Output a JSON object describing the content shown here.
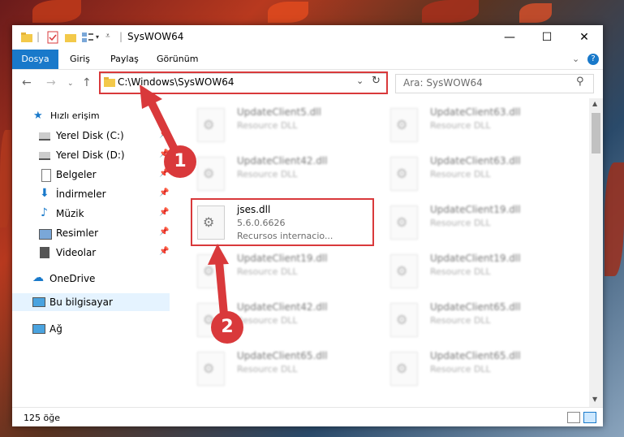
{
  "window": {
    "title": "SysWOW64",
    "minimize": "—",
    "maximize": "☐",
    "close": "✕"
  },
  "ribbon": {
    "tabs": [
      "Dosya",
      "Giriş",
      "Paylaş",
      "Görünüm"
    ]
  },
  "address": {
    "path": "C:\\Windows\\SysWOW64"
  },
  "search": {
    "placeholder": "Ara: SysWOW64"
  },
  "sidebar": {
    "items": [
      {
        "label": "Hızlı erişim",
        "icon": "star-icon"
      },
      {
        "label": "Yerel Disk (C:)",
        "icon": "drive-icon"
      },
      {
        "label": "Yerel Disk (D:)",
        "icon": "drive-icon"
      },
      {
        "label": "Belgeler",
        "icon": "documents-icon"
      },
      {
        "label": "İndirmeler",
        "icon": "download-icon"
      },
      {
        "label": "Müzik",
        "icon": "music-icon"
      },
      {
        "label": "Resimler",
        "icon": "pictures-icon"
      },
      {
        "label": "Videolar",
        "icon": "video-icon"
      },
      {
        "label": "OneDrive",
        "icon": "cloud-icon"
      },
      {
        "label": "Bu bilgisayar",
        "icon": "computer-icon"
      },
      {
        "label": "Ağ",
        "icon": "network-icon"
      }
    ]
  },
  "files": {
    "highlighted": {
      "name": "jses.dll",
      "version": "5.6.0.6626",
      "description": "Recursos internacio..."
    },
    "blurred": [
      {
        "name": "UpdateClient5.dll",
        "type": "Resource DLL"
      },
      {
        "name": "UpdateClient63.dll",
        "type": "Resource DLL"
      },
      {
        "name": "UpdateClient42.dll",
        "type": "Resource DLL"
      },
      {
        "name": "UpdateClient63.dll",
        "type": "Resource DLL"
      },
      {
        "name": "UpdateClient19.dll",
        "type": "Resource DLL"
      },
      {
        "name": "UpdateClient19.dll",
        "type": "Resource DLL"
      },
      {
        "name": "UpdateClient19.dll",
        "type": "Resource DLL"
      },
      {
        "name": "UpdateClient42.dll",
        "type": "Resource DLL"
      },
      {
        "name": "UpdateClient65.dll",
        "type": "Resource DLL"
      },
      {
        "name": "UpdateClient65.dll",
        "type": "Resource DLL"
      },
      {
        "name": "UpdateClient65.dll",
        "type": "Resource DLL"
      }
    ]
  },
  "status": {
    "count": "125 öğe"
  },
  "annotations": {
    "step1": "1",
    "step2": "2"
  },
  "colors": {
    "accent": "#1979ca",
    "highlight": "#d9393b"
  }
}
